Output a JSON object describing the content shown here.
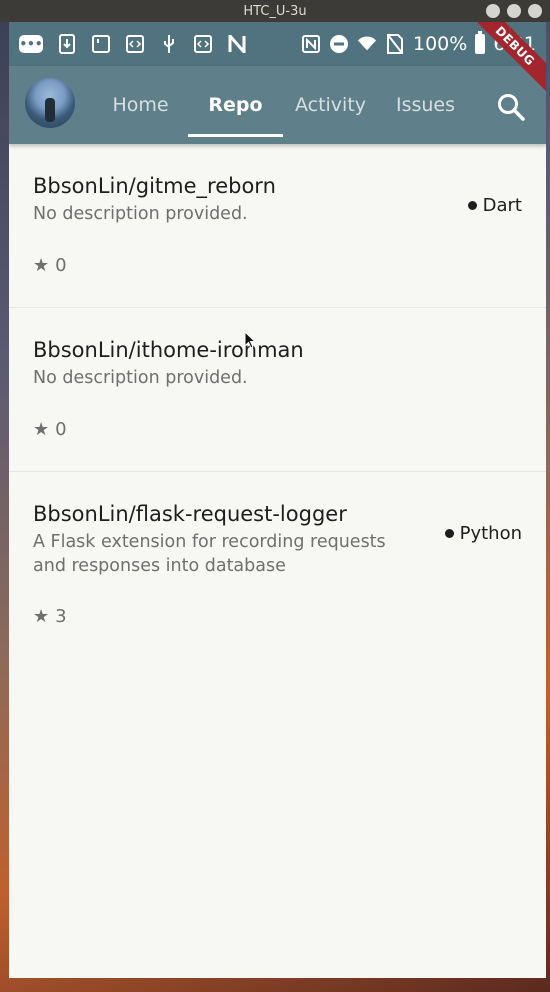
{
  "window": {
    "title": "HTC_U-3u"
  },
  "status_bar": {
    "left_icons": [
      "chat-bubble-icon",
      "download-icon",
      "square-icon",
      "code-icon",
      "usb-icon",
      "code-icon",
      "n-logo-icon"
    ],
    "right_icons": [
      "nfc-icon",
      "do-not-disturb-icon",
      "wifi-icon",
      "no-sim-icon",
      "battery-icon"
    ],
    "battery": "100%",
    "time": "6:31",
    "debug_label": "DEBUG"
  },
  "app_bar": {
    "tabs": [
      {
        "label": "Home",
        "active": false
      },
      {
        "label": "Repo",
        "active": true
      },
      {
        "label": "Activity",
        "active": false
      },
      {
        "label": "Issues",
        "active": false
      }
    ],
    "search_icon": "search-icon"
  },
  "repos": [
    {
      "name": "BbsonLin/gitme_reborn",
      "description": "No description provided.",
      "language": "Dart",
      "stars": "0"
    },
    {
      "name": "BbsonLin/ithome-ironman",
      "description": "No description provided.",
      "language": "",
      "stars": "0"
    },
    {
      "name": "BbsonLin/flask-request-logger",
      "description": "A Flask extension for recording requests and responses into database",
      "language": "Python",
      "stars": "3"
    }
  ],
  "colors": {
    "status_bar": "#50737f",
    "app_bar": "#5f7f8a",
    "background": "#f7f7f4",
    "debug_banner": "#a3262e"
  }
}
